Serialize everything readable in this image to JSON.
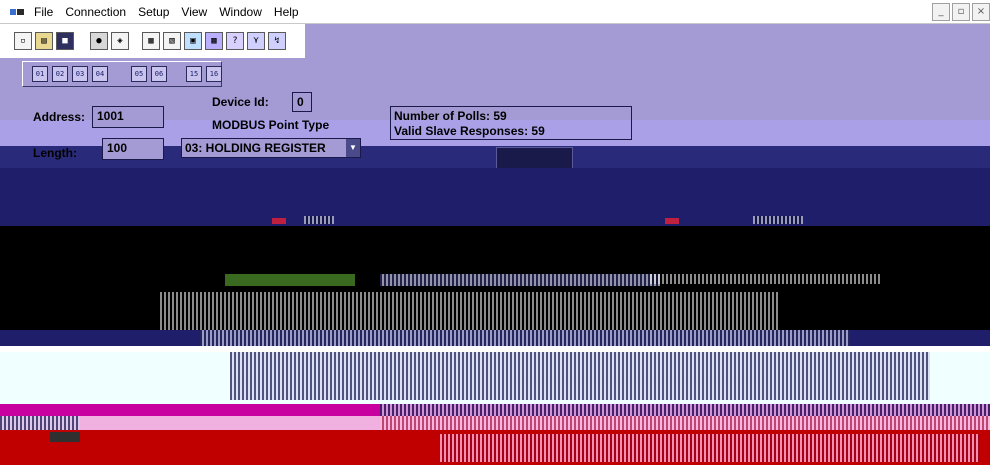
{
  "menu": {
    "items": [
      "File",
      "Connection",
      "Setup",
      "View",
      "Window",
      "Help"
    ]
  },
  "window_buttons": {
    "minimize": "_",
    "restore": "̅",
    "close": "×"
  },
  "setup": {
    "device_id_label": "Device Id:",
    "device_id_value": "0",
    "address_label": "Address:",
    "address_value": "1001",
    "point_type_label": "MODBUS Point Type",
    "length_label": "Length:",
    "length_value": "100",
    "point_type_value": "03: HOLDING REGISTER"
  },
  "stats": {
    "polls_label": "Number of Polls:",
    "polls_value": "59",
    "responses_label": "Valid Slave Responses:",
    "responses_value": "59"
  },
  "colors": {
    "panel": "#a49ad4",
    "dark": "#1e1e6a",
    "pink": "#c800a0",
    "red": "#c00000"
  }
}
